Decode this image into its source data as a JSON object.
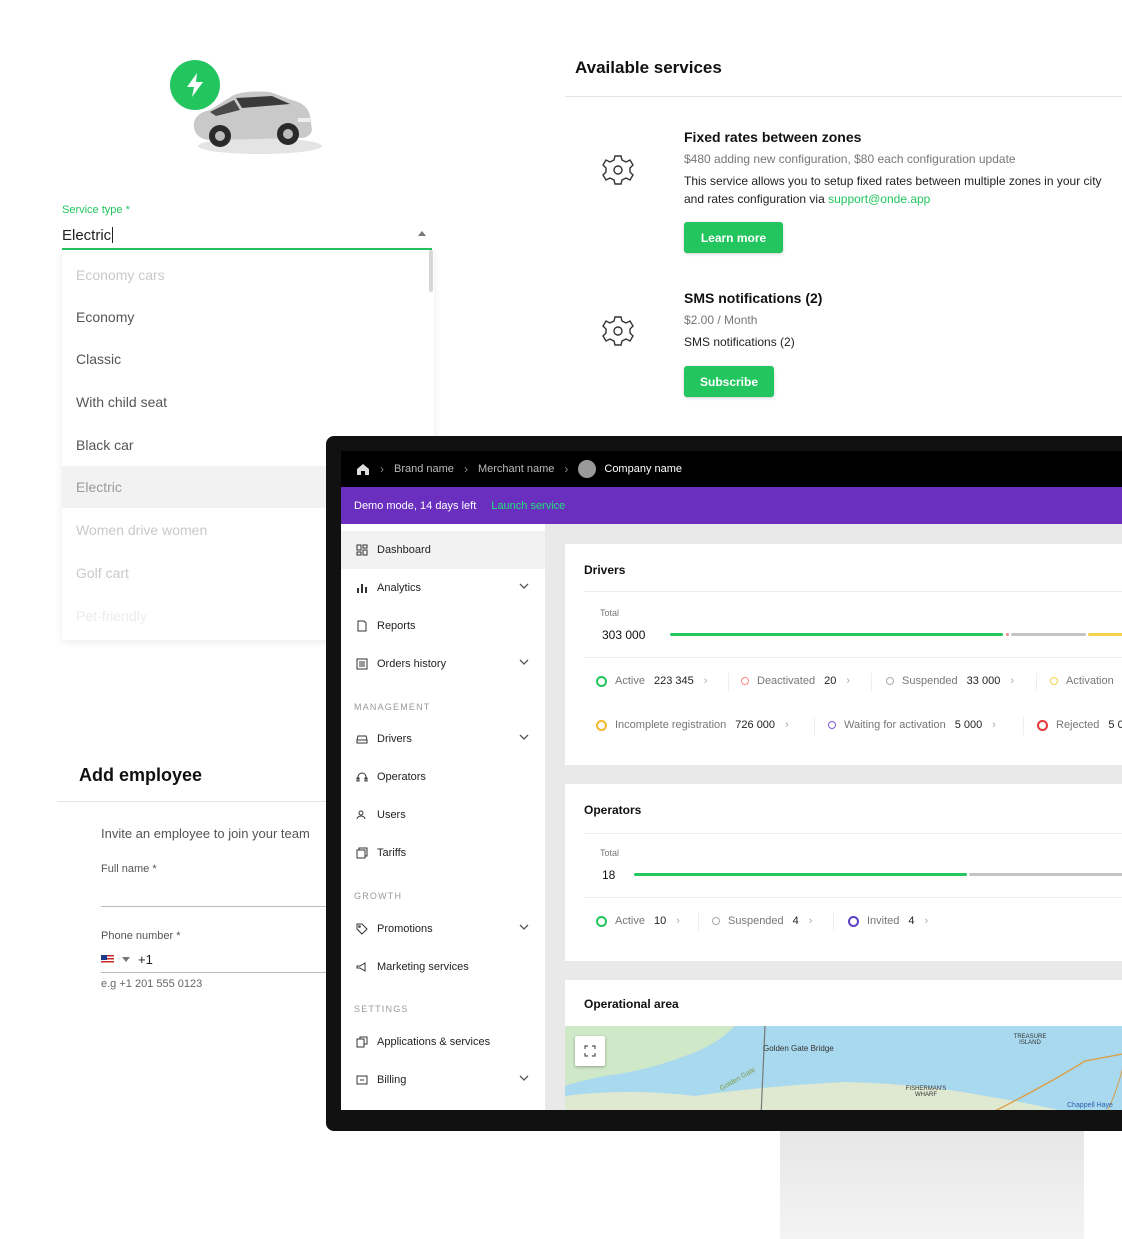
{
  "service_type": {
    "label": "Service type *",
    "value": "Electric",
    "options": [
      "Economy cars",
      "Economy",
      "Classic",
      "With child seat",
      "Black car",
      "Electric",
      "Women drive women",
      "Golf cart",
      "Pet-friendly"
    ],
    "selected": "Electric",
    "accent": "#22c55e"
  },
  "available_services": {
    "title": "Available services",
    "items": [
      {
        "icon": "gear-icon",
        "title": "Fixed rates between zones",
        "price": "$480 adding new configuration, $80 each configuration update",
        "desc_line1": "This service allows you to setup fixed rates between multiple zones in your city",
        "desc_line2_prefix": "and rates configuration via ",
        "link": "support@onde.app",
        "button": "Learn more"
      },
      {
        "icon": "gear-icon",
        "title": "SMS notifications (2)",
        "price": "$2.00 / Month",
        "desc_line1": "SMS notifications (2)",
        "button": "Subscribe"
      }
    ]
  },
  "add_employee": {
    "title": "Add employee",
    "invite": "Invite an employee to join your team",
    "full_name_label": "Full name *",
    "phone_label": "Phone number *",
    "phone_prefix": "+1",
    "phone_hint": "e.g +1 201 555 0123"
  },
  "dashboard": {
    "breadcrumb": [
      "Brand name",
      "Merchant name"
    ],
    "company": "Company name",
    "demo_text": "Demo mode, 14 days left",
    "launch": "Launch service",
    "demo_color": "#6a2fbf",
    "nav": [
      {
        "label": "Dashboard",
        "icon": "dashboard-icon",
        "chevron": false
      },
      {
        "label": "Analytics",
        "icon": "bar-chart-icon",
        "chevron": true
      },
      {
        "label": "Reports",
        "icon": "report-icon",
        "chevron": false
      },
      {
        "label": "Orders history",
        "icon": "list-icon",
        "chevron": true
      }
    ],
    "sections": {
      "management": "MANAGEMENT",
      "growth": "GROWTH",
      "settings": "SETTINGS"
    },
    "nav_management": [
      {
        "label": "Drivers",
        "icon": "car-icon",
        "chevron": true
      },
      {
        "label": "Operators",
        "icon": "headset-icon",
        "chevron": false
      },
      {
        "label": "Users",
        "icon": "users-icon",
        "chevron": false
      },
      {
        "label": "Tariffs",
        "icon": "tariff-icon",
        "chevron": false
      }
    ],
    "nav_growth": [
      {
        "label": "Promotions",
        "icon": "tag-icon",
        "chevron": true
      },
      {
        "label": "Marketing services",
        "icon": "megaphone-icon",
        "chevron": false
      }
    ],
    "nav_settings": [
      {
        "label": "Applications & services",
        "icon": "apps-icon",
        "chevron": false
      },
      {
        "label": "Billing",
        "icon": "billing-icon",
        "chevron": true
      }
    ],
    "drivers": {
      "title": "Drivers",
      "total_label": "Total",
      "total": "303 000",
      "row1": [
        {
          "label": "Active",
          "value": "223 345",
          "color": "#22c55e"
        },
        {
          "label": "Deactivated",
          "value": "20",
          "color": "#f08a8a"
        },
        {
          "label": "Suspended",
          "value": "33 000",
          "color": "#aaaaaa"
        },
        {
          "label": "Activation",
          "value": "",
          "color": "#f5d24a"
        }
      ],
      "row2": [
        {
          "label": "Incomplete registration",
          "value": "726 000",
          "color": "#f5b82e"
        },
        {
          "label": "Waiting for activation",
          "value": "5 000",
          "color": "#7b5bd6"
        },
        {
          "label": "Rejected",
          "value": "5 0",
          "color": "#e53935"
        }
      ]
    },
    "operators": {
      "title": "Operators",
      "total_label": "Total",
      "total": "18",
      "row": [
        {
          "label": "Active",
          "value": "10",
          "color": "#22c55e"
        },
        {
          "label": "Suspended",
          "value": "4",
          "color": "#aaaaaa"
        },
        {
          "label": "Invited",
          "value": "4",
          "color": "#5b3fc4"
        }
      ]
    },
    "area": {
      "title": "Operational area",
      "labels": [
        "Golden Gate Bridge",
        "Golden Gate",
        "TREASURE ISLAND",
        "FISHERMAN'S WHARF",
        "Chappell Haye"
      ]
    }
  }
}
